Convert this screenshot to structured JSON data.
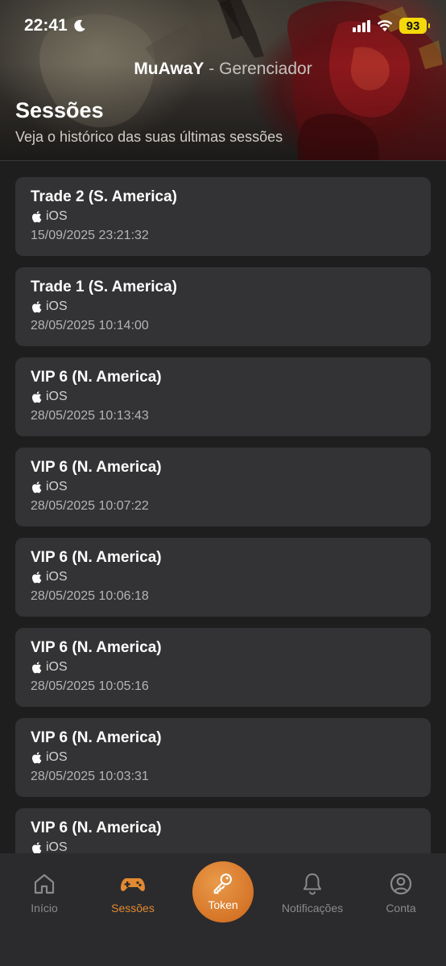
{
  "status_bar": {
    "time": "22:41",
    "battery": "93",
    "icons": [
      "moon-icon",
      "signal-icon",
      "wifi-icon",
      "battery-icon"
    ]
  },
  "header": {
    "brand": "MuAwaY",
    "separator": " - ",
    "subtitle_app": "Gerenciador",
    "page_title": "Sessões",
    "page_subtitle": "Veja o histórico das suas últimas sessões"
  },
  "sessions": [
    {
      "server": "Trade 2 (S. America)",
      "platform": "iOS",
      "datetime": "15/09/2025 23:21:32"
    },
    {
      "server": "Trade 1 (S. America)",
      "platform": "iOS",
      "datetime": "28/05/2025 10:14:00"
    },
    {
      "server": "VIP 6 (N. America)",
      "platform": "iOS",
      "datetime": "28/05/2025 10:13:43"
    },
    {
      "server": "VIP 6 (N. America)",
      "platform": "iOS",
      "datetime": "28/05/2025 10:07:22"
    },
    {
      "server": "VIP 6 (N. America)",
      "platform": "iOS",
      "datetime": "28/05/2025 10:06:18"
    },
    {
      "server": "VIP 6 (N. America)",
      "platform": "iOS",
      "datetime": "28/05/2025 10:05:16"
    },
    {
      "server": "VIP 6 (N. America)",
      "platform": "iOS",
      "datetime": "28/05/2025 10:03:31"
    },
    {
      "server": "VIP 6 (N. America)",
      "platform": "iOS",
      "datetime": ""
    }
  ],
  "tabbar": {
    "items": [
      {
        "label": "Início",
        "icon": "home-icon",
        "active": false
      },
      {
        "label": "Sessões",
        "icon": "gamepad-icon",
        "active": true
      },
      {
        "label": "Token",
        "icon": "key-icon",
        "active": false
      },
      {
        "label": "Notificações",
        "icon": "bell-icon",
        "active": false
      },
      {
        "label": "Conta",
        "icon": "user-circle-icon",
        "active": false
      }
    ]
  },
  "colors": {
    "accent": "#e28a31",
    "background": "#1e1e1f",
    "card": "#333335",
    "tabbar": "#2b2b2d",
    "battery": "#f5d90a"
  }
}
